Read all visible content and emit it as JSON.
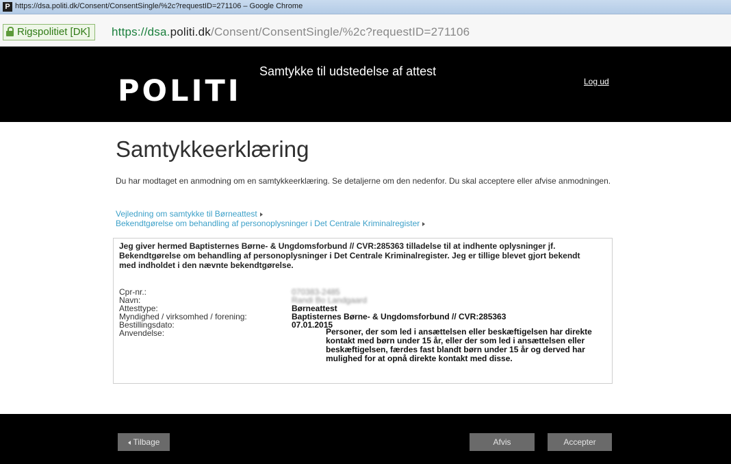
{
  "window": {
    "title": "https://dsa.politi.dk/Consent/ConsentSingle/%2c?requestID=271106 – Google Chrome"
  },
  "addressbar": {
    "security_label": "Rigspolitiet [DK]",
    "url_scheme": "https://",
    "url_host": "dsa.",
    "url_domain": "politi.dk",
    "url_path": "/Consent/ConsentSingle/%2c?requestID=271106"
  },
  "header": {
    "logo": "POLITI",
    "title": "Samtykke til udstedelse af attest",
    "logout": "Log ud"
  },
  "main": {
    "title": "Samtykkeerklæring",
    "intro": "Du har modtaget en anmodning om en samtykkeerklæring. Se detaljerne om den nedenfor. Du skal acceptere eller afvise anmodningen.",
    "links": [
      "Vejledning om samtykke til Børneattest",
      "Bekendtgørelse om behandling af personoplysninger i Det Centrale Kriminalregister"
    ]
  },
  "consent": {
    "statement": "Jeg giver hermed Baptisternes Børne- & Ungdomsforbund // CVR:285363 tilladelse til at indhente oplysninger jf. Bekendtgørelse om behandling af personoplysninger i Det Centrale Kriminalregister. Jeg er tillige blevet gjort bekendt med indholdet i den nævnte bekendtgørelse.",
    "fields": {
      "cpr_label": "Cpr-nr.:",
      "cpr_value": "070383-2485",
      "name_label": "Navn:",
      "name_value": "Randi Bo Landgaard",
      "type_label": "Attesttype:",
      "type_value": "Børneattest",
      "authority_label": "Myndighed / virksomhed / forening:",
      "authority_value": "Baptisternes Børne- & Ungdomsforbund // CVR:285363",
      "date_label": "Bestillingsdato:",
      "date_value": "07.01.2015",
      "use_label": "Anvendelse:",
      "use_value": "Personer, der som led i ansættelsen eller beskæftigelsen har direkte kontakt med børn under 15 år, eller der som led i ansættelsen eller beskæftigelsen, færdes fast blandt børn under 15 år og derved har mulighed for at opnå direkte kontakt med disse."
    }
  },
  "footer": {
    "back": "Tilbage",
    "reject": "Afvis",
    "accept": "Accepter"
  }
}
